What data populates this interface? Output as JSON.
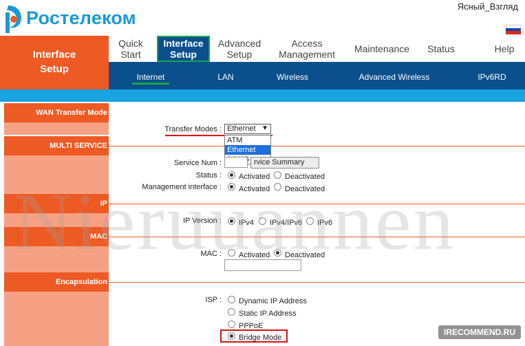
{
  "brand": {
    "name": "Ростелеком",
    "accent": "#ee5a24",
    "logo_color": "#1a9ad6"
  },
  "header": {
    "username": "Ясный_Взгляд"
  },
  "side_title": "Interface Setup",
  "topnav": [
    {
      "label": "Quick Start",
      "active": false
    },
    {
      "label": "Interface Setup",
      "active": true
    },
    {
      "label": "Advanced Setup",
      "active": false
    },
    {
      "label": "Access Management",
      "active": false
    },
    {
      "label": "Maintenance",
      "active": false
    },
    {
      "label": "Status",
      "active": false
    },
    {
      "label": "Help",
      "active": false
    }
  ],
  "subnav": [
    "Internet",
    "LAN",
    "Wireless",
    "Advanced Wireless",
    "IPv6RD"
  ],
  "sections": {
    "wan": "WAN Transfer Mode",
    "multi": "MULTI SERVICE",
    "ip": "IP",
    "mac": "MAC",
    "encap": "Encapsulation"
  },
  "form": {
    "transfer_label": "Transfer Modes :",
    "transfer_value": "Ethernet",
    "transfer_options": [
      "ATM",
      "Ethernet",
      "3G/4G"
    ],
    "service_num_label": "Service Num :",
    "service_summary_btn": "Service Summary",
    "service_summary_visible": "rvice Summary",
    "status_label": "Status :",
    "mgmt_label": "Management interface :",
    "activated": "Activated",
    "deactivated": "Deactivated",
    "ipver_label": "IP Version :",
    "ipver_opts": [
      "IPv4",
      "IPv4/IPv6",
      "IPv6"
    ],
    "mac_label": "MAC :",
    "isp_label": "ISP :",
    "isp_opts": [
      "Dynamic IP Address",
      "Static IP Address",
      "PPPoE",
      "Bridge Mode"
    ],
    "isp_selected": "Bridge Mode"
  },
  "watermark": "Nieruuannen",
  "recommend": "IRECOMMEND.RU"
}
